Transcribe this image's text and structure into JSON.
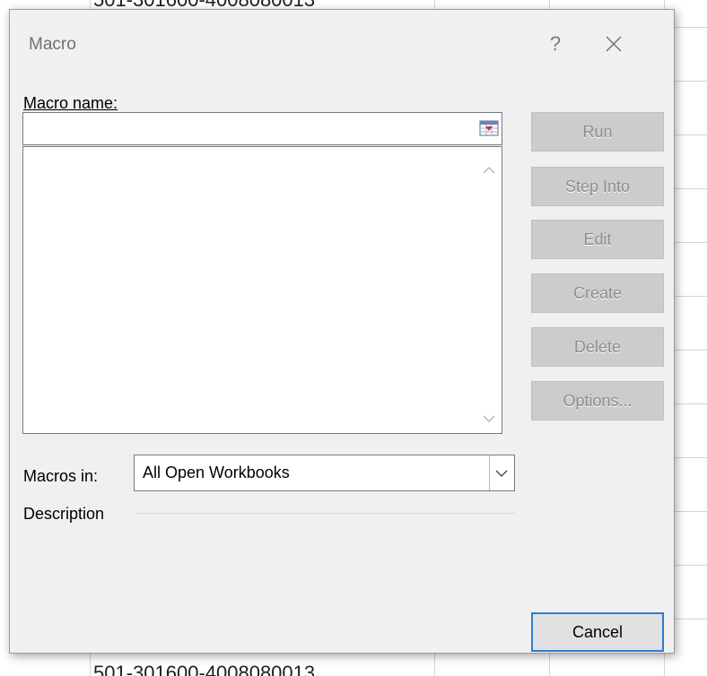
{
  "spreadsheet": {
    "top_cell_text": "501-301600-4008080013",
    "bottom_cell_text": "501-301600-4008080013"
  },
  "dialog": {
    "title": "Macro",
    "help_label": "?",
    "macro_name_label": "Macro name:",
    "macro_name_value": "",
    "macros_in_label": "Macros in:",
    "macros_in_value": "All Open Workbooks",
    "description_label": "Description",
    "buttons": {
      "run": "Run",
      "step_into": "Step Into",
      "edit": "Edit",
      "create": "Create",
      "delete": "Delete",
      "options": "Options...",
      "cancel": "Cancel"
    }
  },
  "icons": {
    "close": "close-icon",
    "ref_edit": "collapse-dialog-icon",
    "scroll_up": "chevron-up-icon",
    "scroll_down": "chevron-down-icon",
    "dropdown": "chevron-down-icon"
  },
  "colors": {
    "dialog_bg": "#f0f0f0",
    "disabled_button_bg": "#cccccc",
    "disabled_text": "#8d8d8d",
    "focus_border": "#2f7bd3"
  }
}
